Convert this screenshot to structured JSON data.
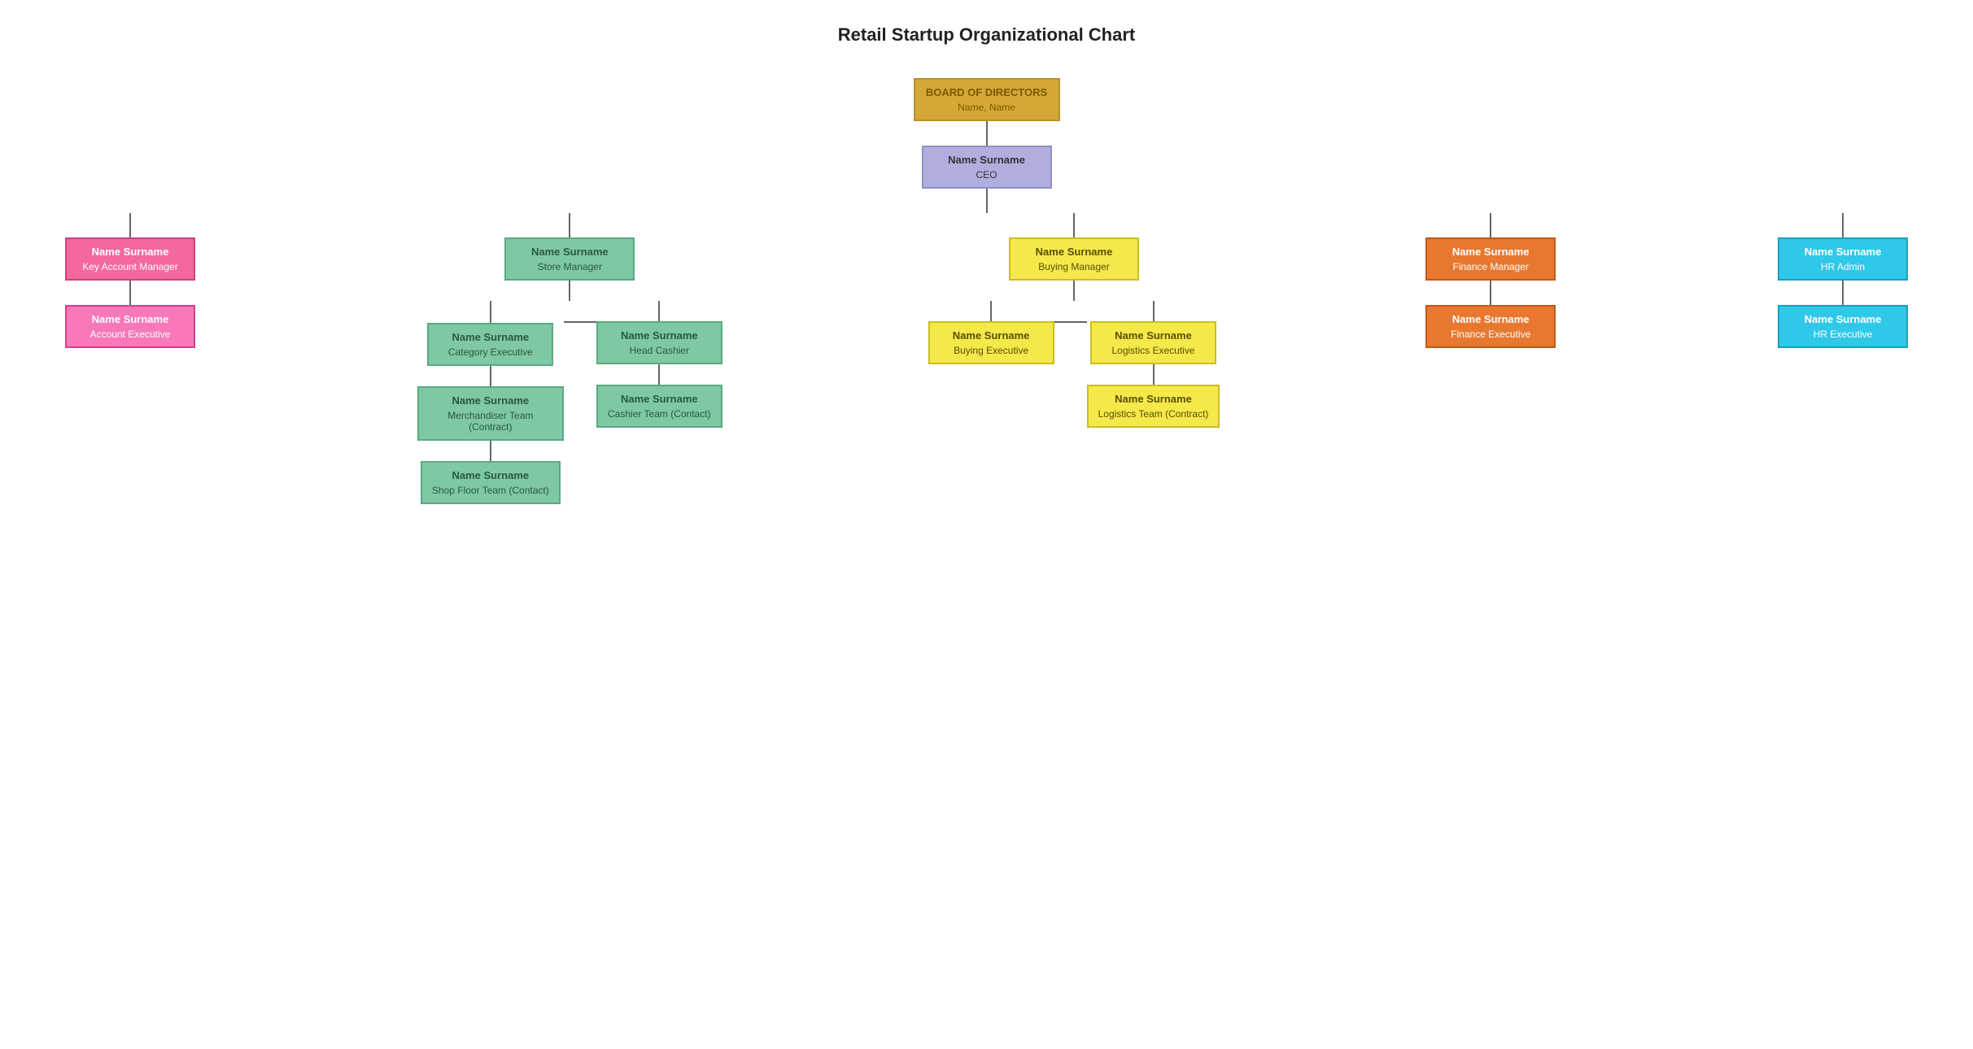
{
  "title": "Retail Startup Organizational Chart",
  "nodes": {
    "board": {
      "name": "BOARD OF DIRECTORS",
      "role": "Name, Name",
      "color": "gold"
    },
    "ceo": {
      "name": "Name Surname",
      "role": "CEO",
      "color": "lavender"
    },
    "kam": {
      "name": "Name Surname",
      "role": "Key Account Manager",
      "color": "pink"
    },
    "storeManager": {
      "name": "Name Surname",
      "role": "Store Manager",
      "color": "green"
    },
    "buyingManager": {
      "name": "Name Surname",
      "role": "Buying Manager",
      "color": "yellow"
    },
    "financeManager": {
      "name": "Name Surname",
      "role": "Finance Manager",
      "color": "orange"
    },
    "hrAdmin": {
      "name": "Name Surname",
      "role": "HR Admin",
      "color": "cyan"
    },
    "accountExec": {
      "name": "Name Surname",
      "role": "Account Executive",
      "color": "pink-light"
    },
    "categoryExec": {
      "name": "Name Surname",
      "role": "Category Executive",
      "color": "green"
    },
    "headCashier": {
      "name": "Name Surname",
      "role": "Head Cashier",
      "color": "green"
    },
    "buyingExec": {
      "name": "Name Surname",
      "role": "Buying Executive",
      "color": "yellow"
    },
    "logisticsExec": {
      "name": "Name Surname",
      "role": "Logistics Executive",
      "color": "yellow"
    },
    "financeExec": {
      "name": "Name Surname",
      "role": "Finance Executive",
      "color": "orange"
    },
    "hrExec": {
      "name": "Name Surname",
      "role": "HR Executive",
      "color": "cyan"
    },
    "merchandiserTeam": {
      "name": "Name Surname",
      "role": "Merchandiser Team (Contract)",
      "color": "green"
    },
    "cashierTeam": {
      "name": "Name Surname",
      "role": "Cashier Team (Contact)",
      "color": "green"
    },
    "logisticsTeam": {
      "name": "Name Surname",
      "role": "Logistics Team (Contract)",
      "color": "yellow"
    },
    "shopFloorTeam": {
      "name": "Name Surname",
      "role": "Shop Floor Team (Contact)",
      "color": "green"
    }
  }
}
